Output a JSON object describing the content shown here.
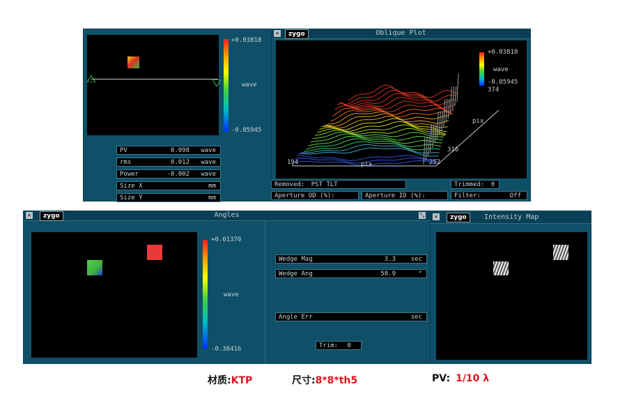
{
  "top_left": {
    "scale_max": "+0.03818",
    "scale_unit": "wave",
    "scale_min": "-0.05945",
    "stats": [
      {
        "label": "PV",
        "value": "0.098",
        "unit": "wave"
      },
      {
        "label": "rms",
        "value": "0.012",
        "unit": "wave"
      },
      {
        "label": "Power",
        "value": "-0.002",
        "unit": "wave"
      },
      {
        "label": "Size X",
        "value": "",
        "unit": "mm"
      },
      {
        "label": "Size Y",
        "value": "",
        "unit": "mm"
      }
    ]
  },
  "oblique": {
    "logo": "zygo",
    "title": "Oblique Plot",
    "scale_max": "+0.03818",
    "scale_unit": "wave",
    "scale_min": "-0.05945",
    "x_start": "194",
    "x_label": "pix",
    "x_end": "252",
    "y_start": "374",
    "y_label": "pix",
    "y_end": "316",
    "removed_label": "Removed:",
    "removed_value": "PST TLT",
    "trimmed_label": "Trimmed:",
    "trimmed_value": "0",
    "aperture_od_label": "Aperture OD (%):",
    "aperture_id_label": "Aperture ID (%):",
    "filter_label": "Filter:",
    "filter_value": "Off"
  },
  "angles": {
    "logo": "zygo",
    "title": "Angles",
    "scale_max": "+0.01370",
    "scale_unit": "wave",
    "scale_min": "-0.38416",
    "wedge_mag_label": "Wedge Mag",
    "wedge_mag_value": "3.3",
    "wedge_mag_unit": "sec",
    "wedge_ang_label": "Wedge Ang",
    "wedge_ang_value": "58.9",
    "wedge_ang_unit": "°",
    "angle_err_label": "Angle Err",
    "angle_err_value": "",
    "angle_err_unit": "sec",
    "trim_label": "Trim:",
    "trim_value": "0"
  },
  "intensity": {
    "logo": "zygo",
    "title": "Intensity Map"
  },
  "caption": {
    "material_label": "材质:",
    "material_value": "KTP",
    "size_label": "尺寸:",
    "size_value": "8*8*th5",
    "pv_label": "PV:",
    "pv_value": "1/10 λ"
  },
  "colors": {
    "panel": "#0f5068",
    "caption_value": "#e0141e"
  }
}
